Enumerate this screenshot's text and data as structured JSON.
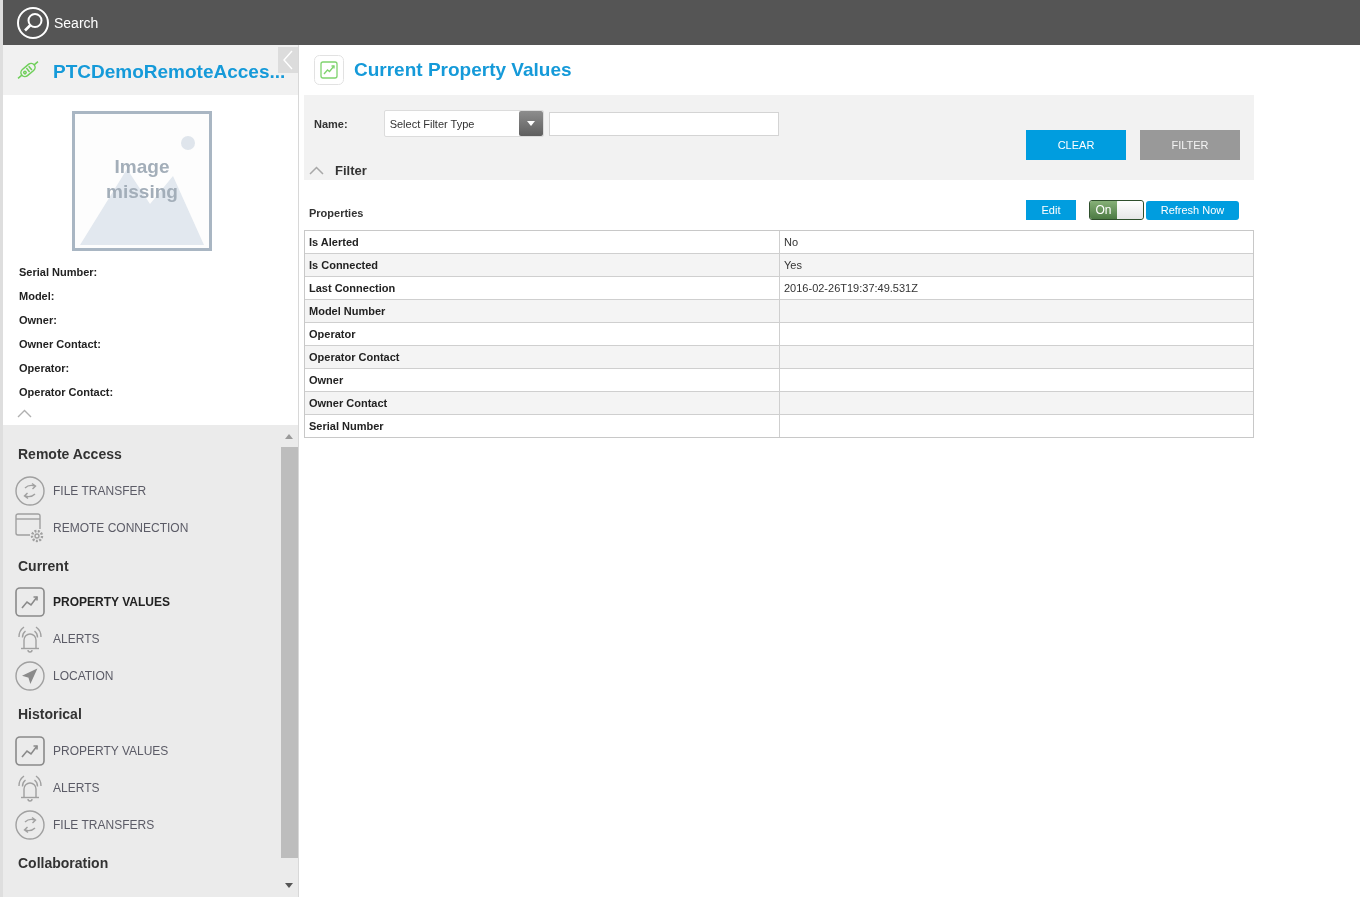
{
  "top_bar": {
    "search_label": "Search"
  },
  "sidebar": {
    "title": "PTCDemoRemoteAcces...",
    "image_placeholder": {
      "text": "Image missing"
    },
    "details_expanded": true,
    "fields": [
      "Serial Number:",
      "Model:",
      "Owner:",
      "Owner Contact:",
      "Operator:",
      "Operator Contact:"
    ],
    "nav_sections": [
      {
        "title": "Remote Access",
        "items": [
          {
            "label": "FILE TRANSFER",
            "kind": "transfer",
            "selected": false
          },
          {
            "label": "REMOTE CONNECTION",
            "kind": "remote",
            "selected": false
          }
        ]
      },
      {
        "title": "Current",
        "items": [
          {
            "label": "PROPERTY VALUES",
            "kind": "chart",
            "selected": true
          },
          {
            "label": "ALERTS",
            "kind": "alert",
            "selected": false
          },
          {
            "label": "LOCATION",
            "kind": "location",
            "selected": false
          }
        ]
      },
      {
        "title": "Historical",
        "items": [
          {
            "label": "PROPERTY VALUES",
            "kind": "chart",
            "selected": false
          },
          {
            "label": "ALERTS",
            "kind": "alert",
            "selected": false
          },
          {
            "label": "FILE TRANSFERS",
            "kind": "transfer",
            "selected": false
          }
        ]
      },
      {
        "title": "Collaboration"
      }
    ]
  },
  "main": {
    "title": "Current Property Values"
  },
  "filter": {
    "name_label": "Name:",
    "filter_type": {
      "value": "Select Filter Type"
    },
    "buttons": [
      {
        "label": "CLEAR",
        "disabled": false
      },
      {
        "label": "FILTER",
        "disabled": true
      }
    ],
    "toggle_label": "Filter",
    "expanded": true
  },
  "properties": {
    "title": "Properties",
    "edit_label": "Edit",
    "auto_refresh": {
      "label": "On",
      "on": true
    },
    "refresh_label": "Refresh Now"
  },
  "table": {
    "rows": [
      {
        "name": "Is Alerted",
        "value": "No"
      },
      {
        "name": "Is Connected",
        "value": "Yes"
      },
      {
        "name": "Last Connection",
        "value": "2016-02-26T19:37:49.531Z"
      },
      {
        "name": "Model Number"
      },
      {
        "name": "Operator"
      },
      {
        "name": "Operator Contact"
      },
      {
        "name": "Owner"
      },
      {
        "name": "Owner Contact"
      },
      {
        "name": "Serial Number"
      }
    ]
  }
}
